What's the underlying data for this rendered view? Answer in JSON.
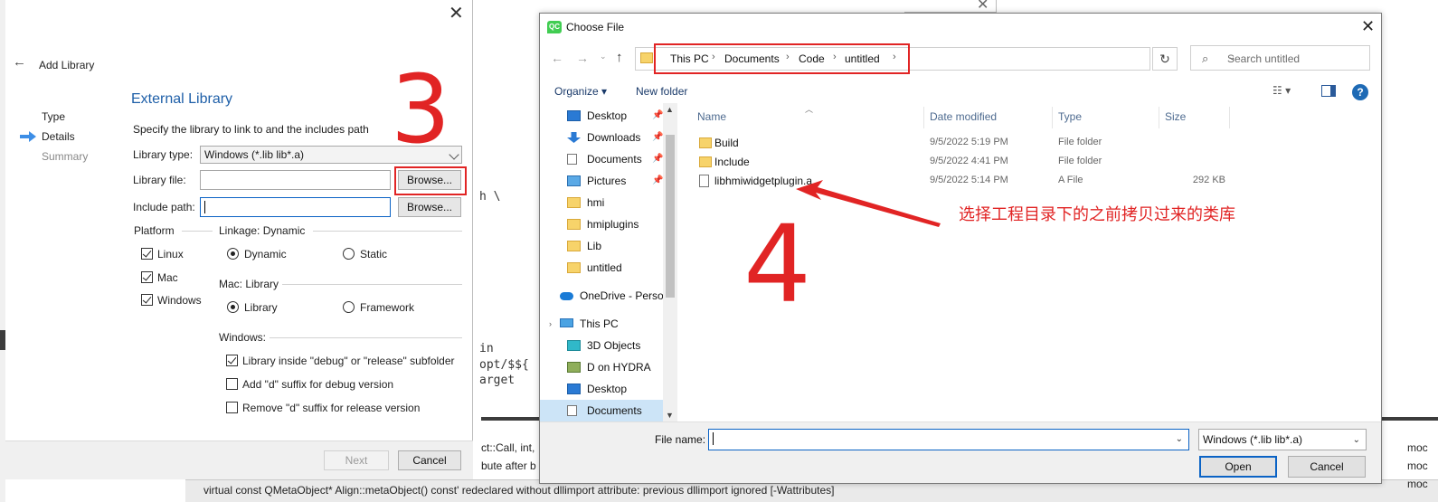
{
  "background": {
    "code_lines": [
      "h \\",
      "in",
      "opt/$${",
      "arget"
    ],
    "issues": [
      "ct::Call, int,",
      "bute after b"
    ],
    "bottom_row": "virtual const QMetaObject* Align::metaObject() const' redeclared without dllimport attribute: previous dllimport ignored [-Wattributes]",
    "right_col": [
      "moc",
      "moc",
      "moc"
    ]
  },
  "add_library": {
    "wizard_title": "Add Library",
    "steps": [
      "Type",
      "Details",
      "Summary"
    ],
    "page_heading": "External Library",
    "description": "Specify the library to link to and the includes path",
    "library_type_label": "Library type:",
    "library_type_value": "Windows (*.lib lib*.a)",
    "library_file_label": "Library file:",
    "include_path_label": "Include path:",
    "browse_label": "Browse...",
    "platform_title": "Platform",
    "platforms": [
      {
        "label": "Linux",
        "checked": true
      },
      {
        "label": "Mac",
        "checked": true
      },
      {
        "label": "Windows",
        "checked": true
      }
    ],
    "linkage_title": "Linkage: Dynamic",
    "linkage_dynamic": "Dynamic",
    "linkage_static": "Static",
    "mac_title": "Mac: Library",
    "mac_library": "Library",
    "mac_framework": "Framework",
    "windows_title": "Windows:",
    "win_options": [
      {
        "label": "Library inside \"debug\" or \"release\" subfolder",
        "checked": true
      },
      {
        "label": "Add \"d\" suffix for debug version",
        "checked": false
      },
      {
        "label": "Remove \"d\" suffix for release version",
        "checked": false
      }
    ],
    "next_label": "Next",
    "cancel_label": "Cancel"
  },
  "choose_file": {
    "title": "Choose File",
    "breadcrumbs": [
      "This PC",
      "Documents",
      "Code",
      "untitled"
    ],
    "search_placeholder": "Search untitled",
    "organize_label": "Organize ▾",
    "new_folder_label": "New folder",
    "nav_items": [
      {
        "label": "Desktop",
        "icon": "desktop-icon",
        "pinned": true
      },
      {
        "label": "Downloads",
        "icon": "downloads-icon",
        "pinned": true
      },
      {
        "label": "Documents",
        "icon": "documents-icon",
        "pinned": true
      },
      {
        "label": "Pictures",
        "icon": "pictures-icon",
        "pinned": true
      },
      {
        "label": "hmi",
        "icon": "folder-icon",
        "pinned": false
      },
      {
        "label": "hmiplugins",
        "icon": "folder-icon",
        "pinned": false
      },
      {
        "label": "Lib",
        "icon": "folder-icon",
        "pinned": false
      },
      {
        "label": "untitled",
        "icon": "folder-icon",
        "pinned": false
      },
      {
        "label": "OneDrive - Person",
        "icon": "onedrive-icon",
        "pinned": false
      },
      {
        "label": "This PC",
        "icon": "this-pc-icon",
        "pinned": false
      },
      {
        "label": "3D Objects",
        "icon": "3d-objects-icon",
        "pinned": false
      },
      {
        "label": "D on HYDRA",
        "icon": "network-drive-icon",
        "pinned": false
      },
      {
        "label": "Desktop",
        "icon": "desktop-icon",
        "pinned": false
      },
      {
        "label": "Documents",
        "icon": "documents-icon",
        "pinned": false
      }
    ],
    "columns": [
      "Name",
      "Date modified",
      "Type",
      "Size"
    ],
    "files": [
      {
        "name": "Build",
        "date": "9/5/2022 5:19 PM",
        "type": "File folder",
        "size": ""
      },
      {
        "name": "Include",
        "date": "9/5/2022 4:41 PM",
        "type": "File folder",
        "size": ""
      },
      {
        "name": "libhmiwidgetplugin.a",
        "date": "9/5/2022 5:14 PM",
        "type": "A File",
        "size": "292 KB"
      }
    ],
    "filename_label": "File name:",
    "filetype_value": "Windows (*.lib lib*.a)",
    "open_label": "Open",
    "cancel_label": "Cancel"
  },
  "annotations": {
    "step3": "3",
    "step4": "4",
    "note": "选择工程目录下的之前拷贝过来的类库",
    "color": "#e12424"
  }
}
